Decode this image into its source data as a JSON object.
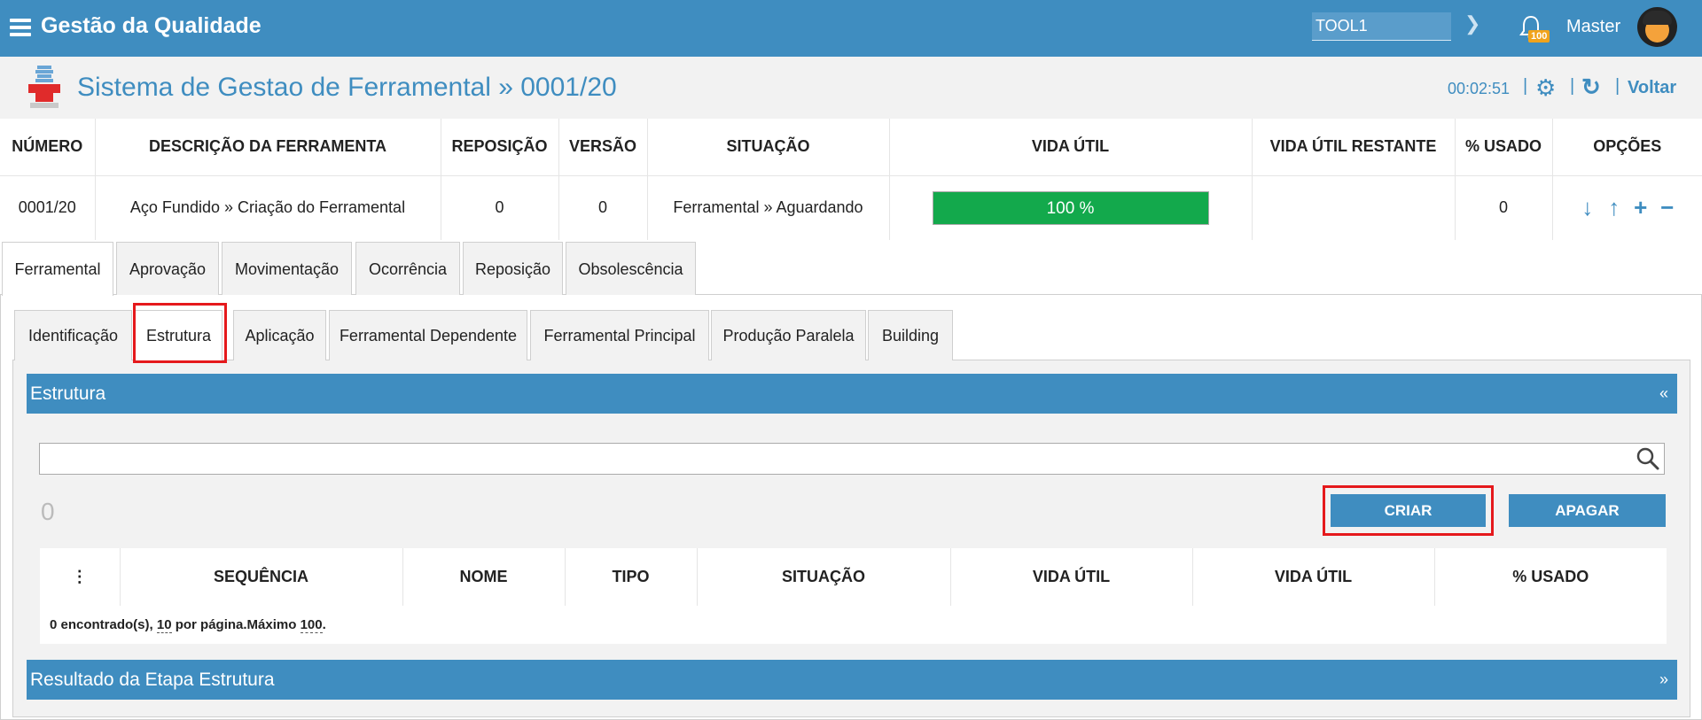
{
  "topbar": {
    "app_title": "Gestão da Qualidade",
    "tool_value": "TOOL1",
    "notification_count": "100",
    "user_name": "Master"
  },
  "subheader": {
    "title": "Sistema de Gestao de Ferramental » 0001/20",
    "timer": "00:02:51",
    "back_label": "Voltar"
  },
  "info_table": {
    "headers": [
      "NÚMERO",
      "DESCRIÇÃO DA FERRAMENTA",
      "REPOSIÇÃO",
      "VERSÃO",
      "SITUAÇÃO",
      "VIDA ÚTIL",
      "VIDA ÚTIL RESTANTE",
      "% USADO",
      "OPÇÕES"
    ],
    "row": {
      "numero": "0001/20",
      "descricao": "Aço Fundido » Criação do Ferramental",
      "reposicao": "0",
      "versao": "0",
      "situacao": "Ferramental » Aguardando",
      "vida_util": "100 %",
      "vida_util_percent": 100,
      "vida_util_restante": "",
      "usado": "0"
    }
  },
  "tabs_main": [
    "Ferramental",
    "Aprovação",
    "Movimentação",
    "Ocorrência",
    "Reposição",
    "Obsolescência"
  ],
  "tabs_sub": [
    "Identificação",
    "Estrutura",
    "Aplicação",
    "Ferramental Dependente",
    "Ferramental Principal",
    "Produção Paralela",
    "Building"
  ],
  "estrutura": {
    "header": "Estrutura",
    "collapse": "«",
    "search_value": "",
    "count": "0",
    "create_label": "CRIAR",
    "delete_label": "APAGAR",
    "grid_headers": [
      "⋮",
      "SEQUÊNCIA",
      "NOME",
      "TIPO",
      "SITUAÇÃO",
      "VIDA ÚTIL",
      "VIDA ÚTIL",
      "% USADO"
    ],
    "footer": {
      "found": "0 encontrado(s), ",
      "per_page": "10",
      "per_page_suffix": " por página.Máximo ",
      "max": "100",
      "end": "."
    }
  },
  "resultado": {
    "header": "Resultado da Etapa Estrutura",
    "expand": "»"
  },
  "colors": {
    "primary": "#3f8dc0",
    "progress": "#13a94c",
    "highlight": "#e5191c"
  }
}
